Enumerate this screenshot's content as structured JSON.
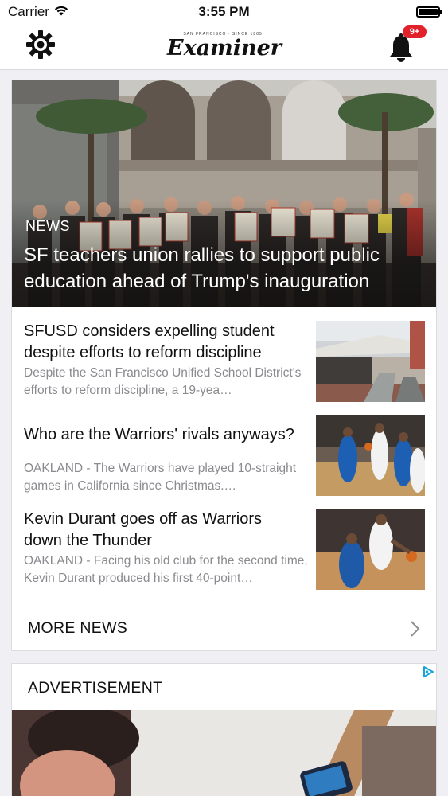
{
  "status_bar": {
    "carrier": "Carrier",
    "time": "3:55 PM"
  },
  "nav": {
    "logo_tagline": "San Francisco · Since 1865",
    "logo_text": "Examiner",
    "notification_badge": "9+",
    "badge_color": "#e1212b"
  },
  "hero": {
    "tag": "NEWS",
    "title": "SF teachers union rallies to support public education ahead of Trump's inauguration"
  },
  "stories": [
    {
      "title": "SFUSD considers expelling student despite efforts to reform discipline",
      "summary": "Despite the San Francisco Unified School District's efforts to reform discipline, a 19-yea…"
    },
    {
      "title": "Who are the Warriors' rivals anyways?",
      "summary": "OAKLAND - The Warriors have played 10-straight games in California since Christmas.…"
    },
    {
      "title": "Kevin Durant goes off as Warriors down the Thunder",
      "summary": "OAKLAND - Facing his old club for the second time, Kevin Durant produced his first 40-point…"
    }
  ],
  "more_news": {
    "label": "MORE NEWS"
  },
  "ad": {
    "label": "ADVERTISEMENT"
  },
  "icons": {
    "settings": "gear-icon",
    "notifications": "bell-icon",
    "more": "chevron-right-icon",
    "ad_choices": "adchoices-icon"
  }
}
